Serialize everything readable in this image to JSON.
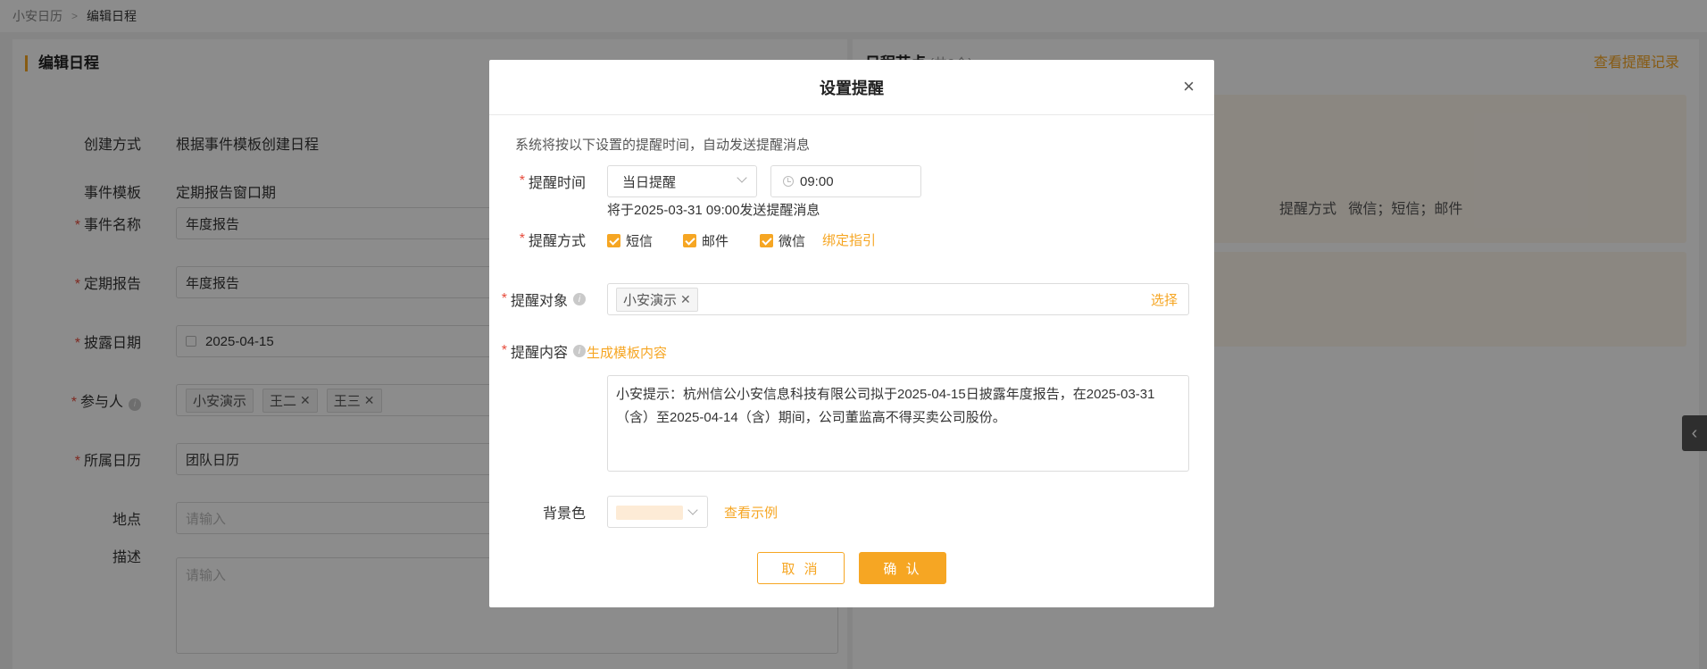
{
  "breadcrumb": {
    "root": "小安日历",
    "current": "编辑日程"
  },
  "left": {
    "title": "编辑日程",
    "rows": {
      "create_method": {
        "label": "创建方式",
        "value": "根据事件模板创建日程"
      },
      "event_template": {
        "label": "事件模板",
        "value": "定期报告窗口期"
      },
      "event_name": {
        "label": "事件名称",
        "value": "年度报告"
      },
      "periodic_report": {
        "label": "定期报告",
        "value": "年度报告"
      },
      "disclosure_date": {
        "label": "披露日期",
        "value": "2025-04-15"
      },
      "participants": {
        "label": "参与人",
        "tags": [
          "小安演示",
          "王二",
          "王三"
        ]
      },
      "calendar": {
        "label": "所属日历",
        "value": "团队日历"
      },
      "location": {
        "label": "地点",
        "placeholder": "请输入"
      },
      "description": {
        "label": "描述",
        "placeholder": "请输入"
      }
    }
  },
  "right": {
    "title": "日程节点",
    "count": "(共2个)",
    "view_records": "查看提醒记录",
    "node_method_label": "提醒方式",
    "node_method_value": "微信；短信；邮件"
  },
  "dialog": {
    "title": "设置提醒",
    "close": "×",
    "note": "系统将按以下设置的提醒时间，自动发送提醒消息",
    "time": {
      "label": "提醒时间",
      "day_option": "当日提醒",
      "time_value": "09:00",
      "hint": "将于2025-03-31 09:00发送提醒消息"
    },
    "method": {
      "label": "提醒方式",
      "options": [
        "短信",
        "邮件",
        "微信"
      ],
      "bind_guide": "绑定指引"
    },
    "target": {
      "label": "提醒对象",
      "tag": "小安演示",
      "choose": "选择"
    },
    "content": {
      "label": "提醒内容",
      "generate": "生成模板内容",
      "text": "小安提示：杭州信公小安信息科技有限公司拟于2025-04-15日披露年度报告，在2025-03-31（含）至2025-04-14（含）期间，公司董监高不得买卖公司股份。"
    },
    "bg_color": {
      "label": "背景色",
      "color": "#fdebd6",
      "view_example": "查看示例"
    },
    "buttons": {
      "cancel": "取 消",
      "ok": "确 认"
    }
  },
  "colors": {
    "accent": "#f6a623",
    "required": "#e74c3c"
  }
}
